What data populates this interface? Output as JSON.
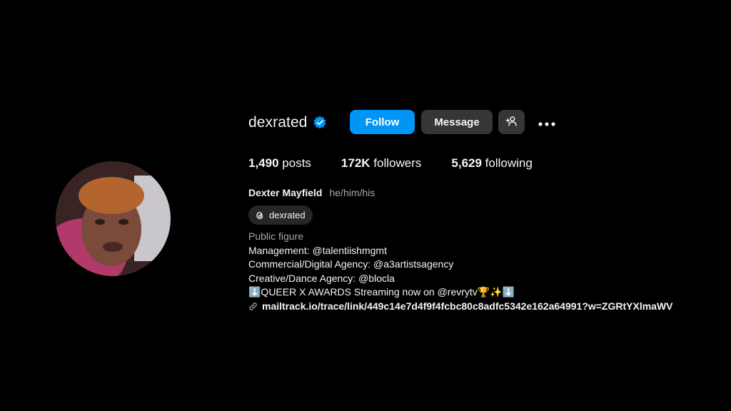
{
  "profile": {
    "username": "dexrated",
    "verified": true,
    "follow_label": "Follow",
    "message_label": "Message",
    "stats": {
      "posts_count": "1,490",
      "posts_label": "posts",
      "followers_count": "172K",
      "followers_label": "followers",
      "following_count": "5,629",
      "following_label": "following"
    },
    "full_name": "Dexter Mayfield",
    "pronouns": "he/him/his",
    "threads_handle": "dexrated",
    "category": "Public figure",
    "bio_lines": [
      "Management: @talentiishmgmt",
      "Commercial/Digital Agency: @a3artistsagency",
      "Creative/Dance Agency: @blocla",
      "⬇️QUEER X AWARDS Streaming now on @revrytv🏆✨⬇️"
    ],
    "link": "mailtrack.io/trace/link/449c14e7d4f9f4fcbc80c8adfc5342e162a64991?w=ZGRtYXlmaWV"
  },
  "colors": {
    "background": "#000000",
    "follow_button": "#0095f6",
    "secondary_button": "#363636",
    "verified_badge": "#0095f6",
    "muted_text": "#a8a8a8"
  },
  "icons": {
    "verified": "verified-badge-icon",
    "suggest": "person-add-icon",
    "more": "more-options-icon",
    "threads": "threads-icon",
    "link": "link-icon"
  }
}
